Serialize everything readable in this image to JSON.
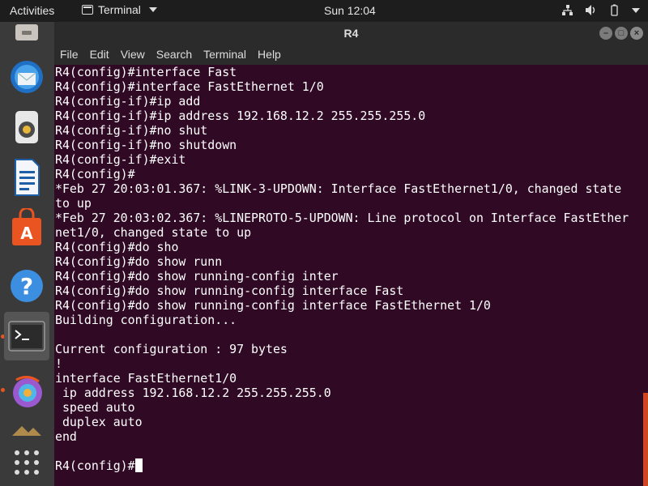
{
  "topbar": {
    "activities": "Activities",
    "app_name": "Terminal",
    "clock": "Sun 12:04",
    "tray_icons": [
      "network-icon",
      "volume-icon",
      "battery-icon",
      "system-menu-icon"
    ]
  },
  "dock": {
    "items": [
      "files-icon",
      "thunderbird-icon",
      "rhythmbox-icon",
      "writer-icon",
      "software-center-icon",
      "help-icon",
      "terminal-icon",
      "unknown-app-icon",
      "app-partial-icon",
      "show-applications-icon"
    ]
  },
  "window": {
    "title": "R4",
    "menu": [
      "File",
      "Edit",
      "View",
      "Search",
      "Terminal",
      "Help"
    ]
  },
  "terminal": {
    "lines": [
      "R4(config)#interface Fast",
      "R4(config)#interface FastEthernet 1/0",
      "R4(config-if)#ip add",
      "R4(config-if)#ip address 192.168.12.2 255.255.255.0",
      "R4(config-if)#no shut",
      "R4(config-if)#no shutdown",
      "R4(config-if)#exit",
      "R4(config)#",
      "*Feb 27 20:03:01.367: %LINK-3-UPDOWN: Interface FastEthernet1/0, changed state",
      "to up",
      "*Feb 27 20:03:02.367: %LINEPROTO-5-UPDOWN: Line protocol on Interface FastEther",
      "net1/0, changed state to up",
      "R4(config)#do sho",
      "R4(config)#do show runn",
      "R4(config)#do show running-config inter",
      "R4(config)#do show running-config interface Fast",
      "R4(config)#do show running-config interface FastEthernet 1/0",
      "Building configuration...",
      "",
      "Current configuration : 97 bytes",
      "!",
      "interface FastEthernet1/0",
      " ip address 192.168.12.2 255.255.255.0",
      " speed auto",
      " duplex auto",
      "end",
      ""
    ],
    "prompt": "R4(config)#"
  },
  "colors": {
    "terminal_bg": "#300a24",
    "accent": "#e95420",
    "topbar_bg": "#1d1d1d",
    "dock_bg": "#3a3a3a"
  }
}
